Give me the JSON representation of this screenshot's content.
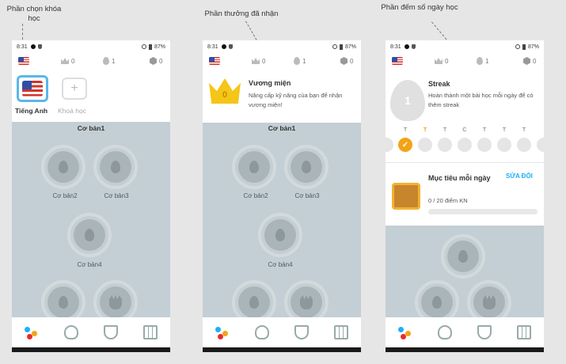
{
  "annotations": {
    "course_selector": "Phần chọn khóa học",
    "rewards": "Phần thưởng đã nhận",
    "streak": "Phần đếm số ngày học"
  },
  "status": {
    "time": "8:31",
    "battery": "87%"
  },
  "topbar": {
    "crowns": "0",
    "streak": "1",
    "gems": "0"
  },
  "screen1": {
    "courses": [
      {
        "label": "Tiếng Anh"
      },
      {
        "label": "Khoá học"
      }
    ],
    "tree": {
      "title": "Cơ bản1",
      "skills": [
        "Cơ bản2",
        "Cơ bản3",
        "Cơ bản4"
      ]
    }
  },
  "screen2": {
    "popup_title": "Vương miện",
    "popup_desc": "Nâng cấp kỹ năng của bạn để nhận vương miện!",
    "crown_count": "0",
    "tree": {
      "title": "Cơ bản1",
      "skills": [
        "Cơ bản2",
        "Cơ bản3",
        "Cơ bản4"
      ]
    }
  },
  "screen3": {
    "streak_title": "Streak",
    "streak_desc": "Hoàn thành một bài học mỗi ngày để có thêm streak",
    "streak_count": "1",
    "days": [
      "T",
      "T",
      "T",
      "C",
      "T",
      "T",
      "T"
    ],
    "goal_title": "Mục tiêu mỗi ngày",
    "goal_edit": "SỬA ĐỔI",
    "goal_progress_text": "0 / 20 điểm KN",
    "goal_progress_fraction": 0
  },
  "colors": {
    "accent": "#f2a417",
    "blue": "#1cb0f6",
    "bg": "#c3cfd4"
  }
}
